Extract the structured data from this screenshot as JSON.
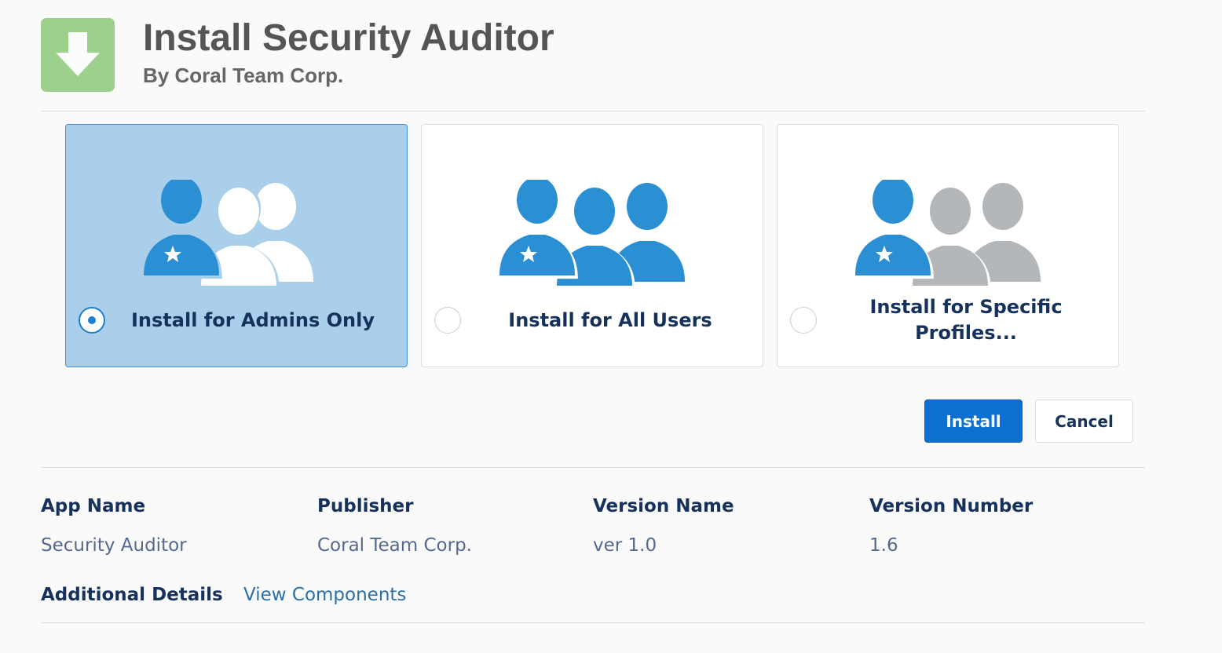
{
  "header": {
    "title": "Install Security Auditor",
    "subtitle": "By Coral Team Corp."
  },
  "options": [
    {
      "label": "Install for Admins Only",
      "selected": true
    },
    {
      "label": "Install for All Users",
      "selected": false
    },
    {
      "label": "Install for Specific Profiles...",
      "selected": false
    }
  ],
  "actions": {
    "install_label": "Install",
    "cancel_label": "Cancel"
  },
  "details": {
    "app_name_label": "App Name",
    "app_name_value": "Security Auditor",
    "publisher_label": "Publisher",
    "publisher_value": "Coral Team Corp.",
    "version_name_label": "Version Name",
    "version_name_value": "ver 1.0",
    "version_number_label": "Version Number",
    "version_number_value": "1.6",
    "additional_label": "Additional Details",
    "view_components_label": "View Components"
  },
  "colors": {
    "selected_bg": "#aacfea",
    "accent_blue": "#0b70d2",
    "user_blue": "#2b8fd4",
    "user_gray": "#b3b7ba",
    "icon_green": "#9bd18c"
  },
  "icons": [
    "download-arrow-icon",
    "admin-user-icon",
    "user-icon",
    "star-icon"
  ]
}
